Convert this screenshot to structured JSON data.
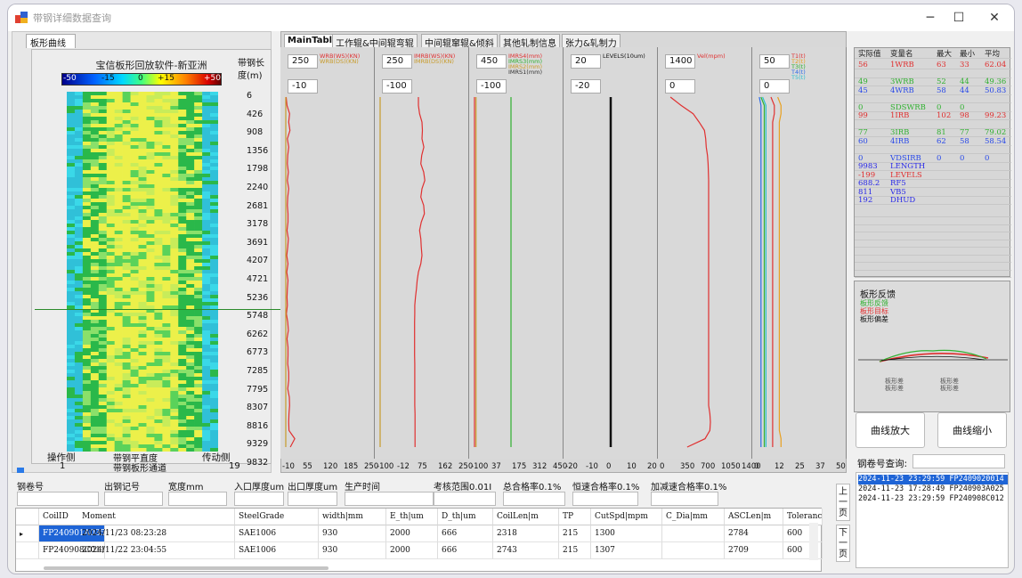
{
  "window": {
    "title": "带钢详细数据查询",
    "minimize": "─",
    "maximize": "☐",
    "close": "✕"
  },
  "left_panel": {
    "tab": "板形曲线",
    "title": "宝信板形回放软件-新亚洲",
    "legend_ticks": [
      "-50",
      "-15",
      "0",
      "+15",
      "+50"
    ],
    "length_header": "带钢长度(m)",
    "length_ticks": [
      "6",
      "426",
      "908",
      "1356",
      "1798",
      "2240",
      "2681",
      "3178",
      "3691",
      "4207",
      "4721",
      "5236",
      "5748",
      "6262",
      "6773",
      "7285",
      "7795",
      "8307",
      "8816",
      "9329",
      "9832"
    ],
    "operator_side": "操作侧",
    "drive_side": "传动侧",
    "bottom_left": "1",
    "bottom_right": "19",
    "flatness_avg": "带钢平直度",
    "flatness_channel": "带钢板形通道"
  },
  "trend_tabs": [
    "MainTable",
    "工作辊&中间辊弯辊",
    "中间辊窜辊&倾斜",
    "其他轧制信息",
    "张力&轧制力"
  ],
  "trend_panels": [
    {
      "top_input": "250",
      "bottom_input": "-10",
      "legend": [
        "WRB(WS)(KN)",
        "WRB(DS)(KN)"
      ],
      "x_ticks": [
        "-10",
        "55",
        "120",
        "185",
        "250"
      ],
      "series": [
        {
          "color": "#e03030",
          "values": [
            -9,
            -6,
            2,
            -1,
            3,
            -5,
            -1,
            -4,
            -5,
            -2,
            -5,
            -1,
            -4,
            -5,
            -3,
            -3,
            -6,
            -2,
            -4,
            -7,
            -3,
            -7,
            -3,
            -5,
            -6,
            -5,
            -8,
            -4,
            -2,
            -6,
            -3,
            -3,
            -4,
            -1,
            -1,
            -4,
            1,
            2,
            0,
            -1,
            0,
            18,
            4
          ]
        },
        {
          "color": "#c89b2a",
          "values": [
            -10,
            -10,
            -10,
            -10,
            -10,
            -10,
            -10,
            -10,
            -10,
            -10,
            -10,
            -10,
            -10,
            -10,
            -10,
            -10,
            -10,
            -10,
            -10,
            -10,
            -10,
            -10,
            -10,
            -10,
            -10,
            -10,
            -10,
            -10,
            -10,
            -10,
            -10,
            -10,
            -10,
            -10,
            -10,
            -10,
            -10,
            -10,
            -10,
            -10,
            -10,
            -10,
            -10
          ]
        }
      ]
    },
    {
      "top_input": "250",
      "bottom_input": "-100",
      "legend": [
        "IMRB(WS)(KN)",
        "IMRB(DS)(KN)"
      ],
      "x_ticks": [
        "-100",
        "-12",
        "75",
        "162",
        "250"
      ],
      "series": [
        {
          "color": "#e03030",
          "values": [
            60,
            60,
            65,
            75,
            77,
            75,
            83,
            74,
            70,
            82,
            87,
            75,
            70,
            82,
            85,
            72,
            65,
            70,
            72,
            75,
            70,
            60,
            55,
            52,
            48,
            45,
            45,
            44,
            44,
            44,
            44,
            44,
            45,
            45,
            45,
            45,
            45,
            45,
            46,
            46,
            46,
            46,
            46
          ]
        },
        {
          "color": "#c89b2a",
          "values": [
            -100,
            -100,
            -100,
            -100,
            -100,
            -100,
            -100,
            -100,
            -100,
            -100,
            -100,
            -100,
            -100,
            -100,
            -100,
            -100,
            -100,
            -100,
            -100,
            -100,
            -100,
            -100,
            -100,
            -100,
            -100,
            -100,
            -100,
            -100,
            -100,
            -100,
            -100,
            -100,
            -100,
            -100,
            -100,
            -100,
            -100,
            -100,
            -100,
            -100,
            -100,
            -100,
            -100
          ]
        }
      ]
    },
    {
      "top_input": "450",
      "bottom_input": "-100",
      "legend": [
        "IMRS4(mm)",
        "IMRS3(mm)",
        "IMRS2(mm)",
        "IMRS1(mm)"
      ],
      "x_ticks": [
        "-100",
        "37",
        "175",
        "312",
        "450"
      ],
      "series": [
        {
          "color": "#e03030",
          "values": [
            -100,
            -100,
            -100,
            -100,
            -100,
            -100,
            -100,
            -100,
            -100,
            -100,
            -100,
            -100,
            -100,
            -100,
            -100,
            -100,
            -100,
            -100,
            -100,
            -100,
            -100,
            -100,
            -100,
            -100,
            -100,
            -100,
            -100,
            -100,
            -100,
            -100,
            -100,
            -100,
            -100,
            -100,
            -100,
            -100,
            -100,
            -100,
            -100,
            -100,
            -100,
            -100,
            -100
          ]
        },
        {
          "color": "#30b030",
          "values": [
            140,
            140,
            140,
            140,
            140,
            140,
            140,
            140,
            140,
            140,
            140,
            140,
            140,
            140,
            140,
            140,
            140,
            140,
            140,
            140,
            140,
            140,
            140,
            140,
            140,
            140,
            140,
            140,
            140,
            140,
            140,
            140,
            140,
            140,
            140,
            140,
            140,
            140,
            140,
            140,
            140,
            140,
            140
          ]
        },
        {
          "color": "#c89b2a",
          "values": [
            -90,
            -90,
            -90,
            -90,
            -90,
            -90,
            -90,
            -90,
            -90,
            -90,
            -90,
            -90,
            -90,
            -90,
            -90,
            -90,
            -90,
            -90,
            -90,
            -90,
            -90,
            -90,
            -90,
            -90,
            -90,
            -90,
            -90,
            -90,
            -90,
            -90,
            -90,
            -90,
            -90,
            -90,
            -90,
            -90,
            -90,
            -90,
            -90,
            -90,
            -90,
            -90,
            -90
          ]
        }
      ]
    },
    {
      "top_input": "20",
      "bottom_input": "-20",
      "legend": [
        "LEVELS(10um)"
      ],
      "x_ticks": [
        "-20",
        "-10",
        "0",
        "10",
        "20"
      ],
      "series": [
        {
          "color": "#111111",
          "values": [
            0,
            0,
            0,
            0,
            0,
            0,
            0,
            0,
            0,
            0,
            0,
            0,
            0,
            0,
            0,
            0,
            0,
            0,
            0,
            0,
            0,
            0,
            0,
            0,
            0,
            0,
            0,
            0,
            0,
            0,
            0,
            0,
            0,
            0,
            0,
            0,
            0,
            0,
            0,
            0,
            0,
            0,
            0
          ]
        }
      ]
    },
    {
      "top_input": "1400",
      "bottom_input": "0",
      "legend": [
        "Vel(mpm)"
      ],
      "x_ticks": [
        "0",
        "350",
        "700",
        "1050",
        "1400"
      ],
      "series": [
        {
          "color": "#e03030",
          "values": [
            120,
            300,
            500,
            600,
            690,
            710,
            720,
            740,
            750,
            755,
            760,
            760,
            760,
            760,
            760,
            760,
            760,
            760,
            760,
            760,
            760,
            760,
            760,
            760,
            760,
            760,
            760,
            760,
            760,
            760,
            760,
            760,
            760,
            760,
            760,
            760,
            760,
            760,
            780,
            790,
            780,
            700,
            400
          ]
        }
      ]
    },
    {
      "top_input": "50",
      "bottom_input": "0",
      "legend": [
        "T1(t)",
        "T2(t)",
        "T3(t)",
        "T4(t)",
        "T5(t)"
      ],
      "x_ticks": [
        "0",
        "12",
        "25",
        "37",
        "50"
      ],
      "series": [
        {
          "color": "#e03030",
          "values": [
            8,
            10,
            10,
            9,
            9,
            9,
            9,
            9,
            9,
            9,
            9,
            9,
            9,
            9,
            9,
            9,
            9,
            9,
            9,
            9,
            9,
            9,
            9,
            9,
            9,
            9,
            9,
            9,
            9,
            9,
            9,
            9,
            9,
            9,
            9,
            9,
            9,
            9,
            9,
            9,
            9,
            9,
            9
          ]
        },
        {
          "color": "#e8a020",
          "values": [
            12,
            14,
            14,
            13,
            13,
            13,
            13,
            13,
            13,
            13,
            13,
            13,
            13,
            13,
            13,
            13,
            13,
            13,
            13,
            13,
            13,
            13,
            13,
            13,
            13,
            13,
            13,
            13,
            13,
            13,
            13,
            13,
            13,
            13,
            13,
            13,
            13,
            13,
            13,
            13,
            13,
            14,
            14
          ]
        },
        {
          "color": "#30b030",
          "values": [
            2,
            4,
            4,
            4,
            4,
            4,
            4,
            4,
            4,
            4,
            4,
            4,
            4,
            4,
            4,
            4,
            4,
            4,
            4,
            4,
            4,
            4,
            4,
            4,
            4,
            4,
            4,
            4,
            4,
            4,
            4,
            4,
            4,
            4,
            4,
            4,
            4,
            4,
            4,
            4,
            4,
            4,
            4
          ]
        },
        {
          "color": "#2a6ae8",
          "values": [
            1,
            2,
            2,
            2,
            2,
            2,
            2,
            2,
            2,
            2,
            2,
            2,
            2,
            2,
            2,
            2,
            2,
            2,
            2,
            2,
            2,
            2,
            2,
            2,
            2,
            2,
            2,
            2,
            2,
            2,
            2,
            2,
            2,
            2,
            2,
            2,
            2,
            2,
            2,
            2,
            2,
            2,
            2
          ]
        },
        {
          "color": "#30c0d0",
          "values": [
            3,
            5,
            5,
            5,
            5,
            5,
            5,
            5,
            5,
            5,
            5,
            5,
            5,
            5,
            5,
            5,
            5,
            5,
            5,
            5,
            5,
            5,
            5,
            5,
            5,
            5,
            5,
            5,
            5,
            5,
            5,
            5,
            5,
            5,
            5,
            5,
            5,
            5,
            5,
            5,
            5,
            5,
            5
          ]
        }
      ]
    }
  ],
  "right_panel": {
    "headers": [
      "实际值",
      "变量名",
      "最大",
      "最小",
      "平均"
    ],
    "rows": [
      {
        "vals": [
          "56",
          "1WRB",
          "63",
          "33",
          "62.04"
        ],
        "color": "#e03030"
      },
      {
        "vals": [
          "",
          "",
          "",
          "",
          ""
        ],
        "color": "#c89b2a"
      },
      {
        "vals": [
          "49",
          "3WRB",
          "52",
          "44",
          "49.36"
        ],
        "color": "#30b030"
      },
      {
        "vals": [
          "45",
          "4WRB",
          "58",
          "44",
          "50.83"
        ],
        "color": "#2a4ae8"
      },
      {
        "vals": [
          "",
          "",
          "",
          "",
          ""
        ],
        "color": "#30c0d0"
      },
      {
        "vals": [
          "0",
          "SDSWRB",
          "0",
          "0",
          ""
        ],
        "color": "#30b030"
      },
      {
        "vals": [
          "99",
          "1IRB",
          "102",
          "98",
          "99.23"
        ],
        "color": "#e03030"
      },
      {
        "vals": [
          "",
          "",
          "",
          "",
          ""
        ],
        "color": "#c89b2a"
      },
      {
        "vals": [
          "77",
          "3IRB",
          "81",
          "77",
          "79.02"
        ],
        "color": "#30b030"
      },
      {
        "vals": [
          "60",
          "4IRB",
          "62",
          "58",
          "58.54"
        ],
        "color": "#2a4ae8"
      },
      {
        "vals": [
          "",
          "",
          "",
          "",
          ""
        ],
        "color": "#c89b2a"
      },
      {
        "vals": [
          "0",
          "VDSIRB",
          "0",
          "0",
          "0"
        ],
        "color": "#2a4ae8"
      },
      {
        "vals": [
          "9983",
          "LENGTH",
          "",
          "",
          ""
        ],
        "color": "#2a2ae8"
      },
      {
        "vals": [
          "-199",
          "LEVELS",
          "",
          "",
          ""
        ],
        "color": "#e03030"
      },
      {
        "vals": [
          "688.2",
          "RF5",
          "",
          "",
          ""
        ],
        "color": "#2a2ae8"
      },
      {
        "vals": [
          "811",
          "VB5",
          "",
          "",
          ""
        ],
        "color": "#2a2ae8"
      },
      {
        "vals": [
          "192",
          "DHUD",
          "",
          "",
          ""
        ],
        "color": "#2a2ae8"
      }
    ],
    "profile_title": "板形反馈",
    "profile_legend": [
      "板形反馈",
      "板形目标",
      "板形偏差"
    ],
    "profile_labels_left": [
      "板形差",
      "板形差"
    ],
    "profile_labels_right": [
      "板形差",
      "板形差"
    ],
    "zoom_in": "曲线放大",
    "zoom_out": "曲线缩小",
    "coil_query": "钢卷号查询:",
    "coil_list": [
      "2024-11-23 23:29:59 FP2409020014",
      "2024-11-23 17:28:49 FP240903A025",
      "2024-11-23 23:29:59 FP240908C012"
    ]
  },
  "filters": {
    "labels": [
      "钢卷号",
      "出钢记号",
      "宽度mm",
      "入口厚度um",
      "出口厚度um",
      "生产时间",
      "考核范围0.01I",
      "总合格率0.1%",
      "恒速合格率0.1%",
      "加减速合格率0.1%"
    ],
    "page_up": "上一页",
    "page_down": "下一页"
  },
  "grid": {
    "headers": [
      "CoilID",
      "Moment",
      "SteelGrade",
      "width|mm",
      "E_th|um",
      "D_th|um",
      "CoilLen|m",
      "TP",
      "CutSpd|mpm",
      "C_Dia|mm",
      "ASCLen|m",
      "Tolerance"
    ],
    "rows": [
      [
        "FP240901A035",
        "2024/11/23 08:23:28",
        "SAE1006",
        "930",
        "2000",
        "666",
        "2318",
        "215",
        "1300",
        "",
        "2784",
        "600"
      ],
      [
        "FP240908C011",
        "2024/11/22 23:04:55",
        "SAE1006",
        "930",
        "2000",
        "666",
        "2743",
        "215",
        "1307",
        "",
        "2709",
        "600"
      ]
    ],
    "row_marker": "▸"
  }
}
